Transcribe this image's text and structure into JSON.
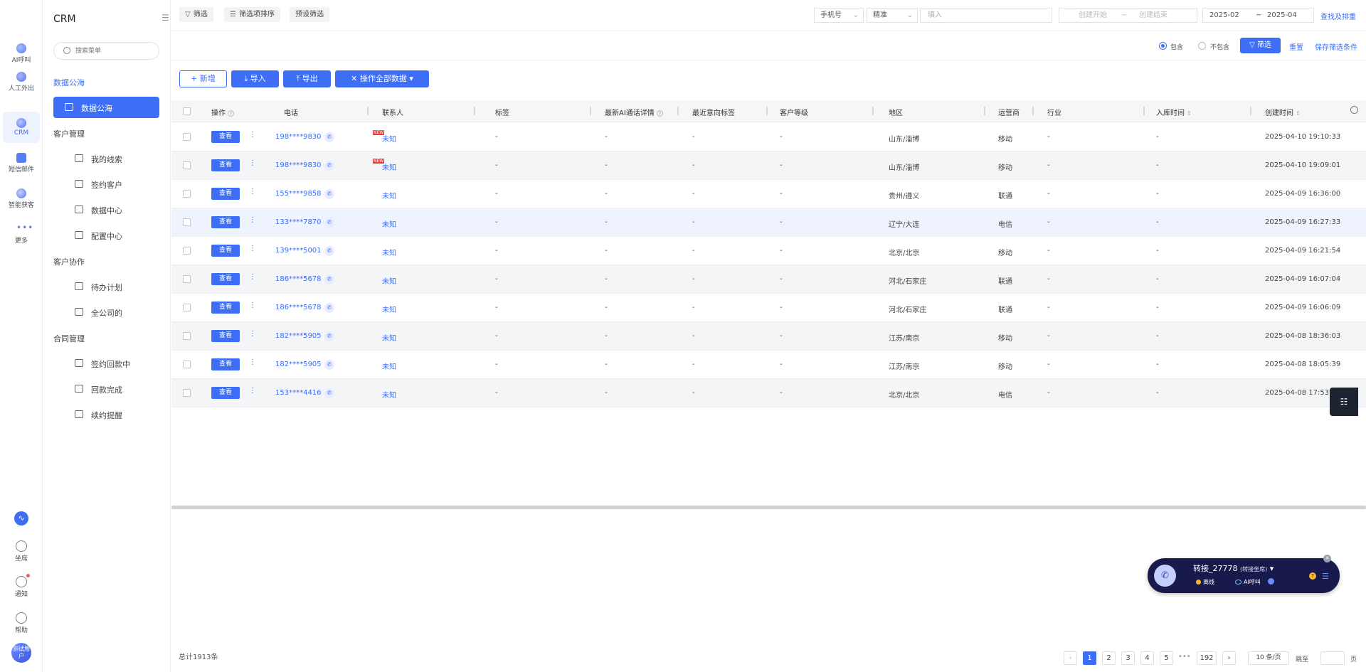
{
  "rail": {
    "items": [
      {
        "label": "AI呼叫"
      },
      {
        "label": "人工外出"
      },
      {
        "label": "CRM"
      },
      {
        "label": "短信邮件"
      },
      {
        "label": "智能获客"
      },
      {
        "label": "更多"
      }
    ],
    "bottom": [
      {
        "label": "坐席"
      },
      {
        "label": "通知"
      },
      {
        "label": "帮助"
      }
    ],
    "avatar_text": "测试用户"
  },
  "sidebar": {
    "title": "CRM",
    "search_placeholder": "搜索菜单",
    "groups": [
      {
        "label": "数据公海"
      },
      {
        "label": "客户管理"
      },
      {
        "label": "客户协作"
      },
      {
        "label": "合同管理"
      }
    ],
    "items": [
      {
        "label": "数据公海"
      },
      {
        "label": "我的线索"
      },
      {
        "label": "签约客户"
      },
      {
        "label": "数据中心"
      },
      {
        "label": "配置中心"
      },
      {
        "label": "待办计划"
      },
      {
        "label": "全公司的"
      },
      {
        "label": "签约回款中"
      },
      {
        "label": "回款完成"
      },
      {
        "label": "续约提醒"
      }
    ]
  },
  "filterbar": {
    "filter_label": "筛选",
    "sort_label": "筛选项排序",
    "preset_label": "预设筛选",
    "field_select": "手机号",
    "match_select": "精准",
    "input_placeholder": "填入",
    "create_start": "创建开始",
    "create_sep": "~",
    "create_end": "创建结束",
    "date_start": "2025-02",
    "date_sep": "~",
    "date_end": "2025-04",
    "search_link": "查找及排重"
  },
  "filterbar2": {
    "include": "包含",
    "exclude": "不包含",
    "filter_btn": "筛选",
    "reset": "重置",
    "save": "保存筛选条件"
  },
  "actions": {
    "add": "新增",
    "import": "导入",
    "export": "导出",
    "operate_all": "操作全部数据"
  },
  "table": {
    "headers": [
      "操作",
      "电话",
      "联系人",
      "标签",
      "最新AI通话详情",
      "最近意向标签",
      "客户等级",
      "地区",
      "运营商",
      "行业",
      "入库时间",
      "创建时间"
    ],
    "view_label": "查看",
    "more_label": "⋮",
    "new_badge": "NEW",
    "rows": [
      {
        "phone": "198****9830",
        "contact": "未知",
        "new": true,
        "tag": "-",
        "ai": "-",
        "intent": "-",
        "level": "-",
        "region": "山东/淄博",
        "carrier": "移动",
        "industry": "-",
        "stored": "-",
        "created": "2025-04-10 19:10:33"
      },
      {
        "phone": "198****9830",
        "contact": "未知",
        "new": true,
        "tag": "-",
        "ai": "-",
        "intent": "-",
        "level": "-",
        "region": "山东/淄博",
        "carrier": "移动",
        "industry": "-",
        "stored": "-",
        "created": "2025-04-10 19:09:01"
      },
      {
        "phone": "155****9858",
        "contact": "未知",
        "new": false,
        "tag": "-",
        "ai": "-",
        "intent": "-",
        "level": "-",
        "region": "贵州/遵义",
        "carrier": "联通",
        "industry": "-",
        "stored": "-",
        "created": "2025-04-09 16:36:00"
      },
      {
        "phone": "133****7870",
        "contact": "未知",
        "new": false,
        "tag": "-",
        "ai": "-",
        "intent": "-",
        "level": "-",
        "region": "辽宁/大连",
        "carrier": "电信",
        "industry": "-",
        "stored": "-",
        "created": "2025-04-09 16:27:33"
      },
      {
        "phone": "139****5001",
        "contact": "未知",
        "new": false,
        "tag": "-",
        "ai": "-",
        "intent": "-",
        "level": "-",
        "region": "北京/北京",
        "carrier": "移动",
        "industry": "-",
        "stored": "-",
        "created": "2025-04-09 16:21:54"
      },
      {
        "phone": "186****5678",
        "contact": "未知",
        "new": false,
        "tag": "-",
        "ai": "-",
        "intent": "-",
        "level": "-",
        "region": "河北/石家庄",
        "carrier": "联通",
        "industry": "-",
        "stored": "-",
        "created": "2025-04-09 16:07:04"
      },
      {
        "phone": "186****5678",
        "contact": "未知",
        "new": false,
        "tag": "-",
        "ai": "-",
        "intent": "-",
        "level": "-",
        "region": "河北/石家庄",
        "carrier": "联通",
        "industry": "-",
        "stored": "-",
        "created": "2025-04-09 16:06:09"
      },
      {
        "phone": "182****5905",
        "contact": "未知",
        "new": false,
        "tag": "-",
        "ai": "-",
        "intent": "-",
        "level": "-",
        "region": "江苏/南京",
        "carrier": "移动",
        "industry": "-",
        "stored": "-",
        "created": "2025-04-08 18:36:03"
      },
      {
        "phone": "182****5905",
        "contact": "未知",
        "new": false,
        "tag": "-",
        "ai": "-",
        "intent": "-",
        "level": "-",
        "region": "江苏/南京",
        "carrier": "移动",
        "industry": "-",
        "stored": "-",
        "created": "2025-04-08 18:05:39"
      },
      {
        "phone": "153****4416",
        "contact": "未知",
        "new": false,
        "tag": "-",
        "ai": "-",
        "intent": "-",
        "level": "-",
        "region": "北京/北京",
        "carrier": "电信",
        "industry": "-",
        "stored": "-",
        "created": "2025-04-08 17:53:"
      }
    ]
  },
  "phone_widget": {
    "title": "转接_27778",
    "subtitle": "(转接坐席)",
    "status": "离线",
    "ai": "AI呼叫"
  },
  "footer": {
    "total": "总计1913条",
    "pages": [
      "1",
      "2",
      "3",
      "4",
      "5"
    ],
    "ellipsis": "•••",
    "last_page": "192",
    "page_size": "10 条/页",
    "jump": "跳至",
    "unit": "页"
  },
  "colors": {
    "accent": "#3d6ef5",
    "widget_bg": "#171a4a"
  }
}
